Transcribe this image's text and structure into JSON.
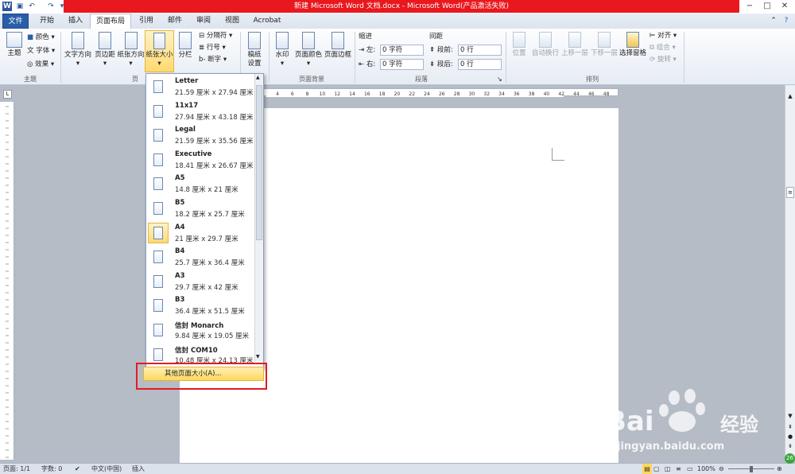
{
  "window": {
    "title": "新建 Microsoft Word 文档.docx - Microsoft Word(产品激活失败)"
  },
  "tabs": [
    "文件",
    "开始",
    "插入",
    "页面布局",
    "引用",
    "邮件",
    "审阅",
    "视图",
    "Acrobat"
  ],
  "ribbon": {
    "theme": {
      "big": "主题",
      "colors": "颜色",
      "fonts": "字体",
      "effects": "效果",
      "group": "主题"
    },
    "page_setup": {
      "text_direction": "文字方向",
      "margins": "页边距",
      "orientation": "纸张方向",
      "size": "纸张大小",
      "columns": "分栏",
      "breaks": "分隔符",
      "line_numbers": "行号",
      "hyphenation": "断字",
      "group": "页"
    },
    "manuscript": {
      "label1": "稿纸",
      "label2": "设置"
    },
    "background": {
      "watermark": "水印",
      "page_color": "页面颜色",
      "page_borders": "页面边框",
      "group": "页面背景"
    },
    "paragraph": {
      "indent": "缩进",
      "spacing": "间距",
      "left": "左:",
      "right": "右:",
      "before": "段前:",
      "after": "段后:",
      "left_value": "0 字符",
      "right_value": "0 字符",
      "before_value": "0 行",
      "after_value": "0 行",
      "group": "段落"
    },
    "arrange": {
      "position": "位置",
      "wrap": "自动换行",
      "forward": "上移一层",
      "backward": "下移一层",
      "pane": "选择窗格",
      "align": "对齐",
      "group_btn": "组合",
      "rotate": "旋转",
      "group": "排列"
    }
  },
  "paper_sizes": [
    {
      "name": "Letter",
      "dims": "21.59 厘米 x 27.94 厘米"
    },
    {
      "name": "11x17",
      "dims": "27.94 厘米 x 43.18 厘米"
    },
    {
      "name": "Legal",
      "dims": "21.59 厘米 x 35.56 厘米"
    },
    {
      "name": "Executive",
      "dims": "18.41 厘米 x 26.67 厘米"
    },
    {
      "name": "A5",
      "dims": "14.8 厘米 x 21 厘米"
    },
    {
      "name": "B5",
      "dims": "18.2 厘米 x 25.7 厘米"
    },
    {
      "name": "A4",
      "dims": "21 厘米 x 29.7 厘米"
    },
    {
      "name": "B4",
      "dims": "25.7 厘米 x 36.4 厘米"
    },
    {
      "name": "A3",
      "dims": "29.7 厘米 x 42 厘米"
    },
    {
      "name": "B3",
      "dims": "36.4 厘米 x 51.5 厘米"
    },
    {
      "name": "信封 Monarch",
      "dims": "9.84 厘米 x 19.05 厘米"
    },
    {
      "name": "信封 COM10",
      "dims": "10.48 厘米 x 24.13 厘米"
    }
  ],
  "selected_size": "A4",
  "more_sizes": "其他页面大小(A)...",
  "status": {
    "page": "页面: 1/1",
    "words": "字数: 0",
    "language": "中文(中国)",
    "mode": "插入",
    "zoom": "100%"
  },
  "watermark": {
    "brand": "Bai",
    "brand_suffix": "经验",
    "url": "jingyan.baidu.com"
  },
  "ruler_labels": [
    "4",
    "6",
    "8",
    "10",
    "12",
    "14",
    "16",
    "18",
    "20",
    "22",
    "24",
    "26",
    "28",
    "30",
    "32",
    "34",
    "36",
    "38",
    "40",
    "42",
    "44",
    "46",
    "48"
  ],
  "colors": {
    "accent": "#2a5ea9",
    "title_red": "#e8181e",
    "highlight": "#ffd85c",
    "annotation": "#e41b23"
  }
}
